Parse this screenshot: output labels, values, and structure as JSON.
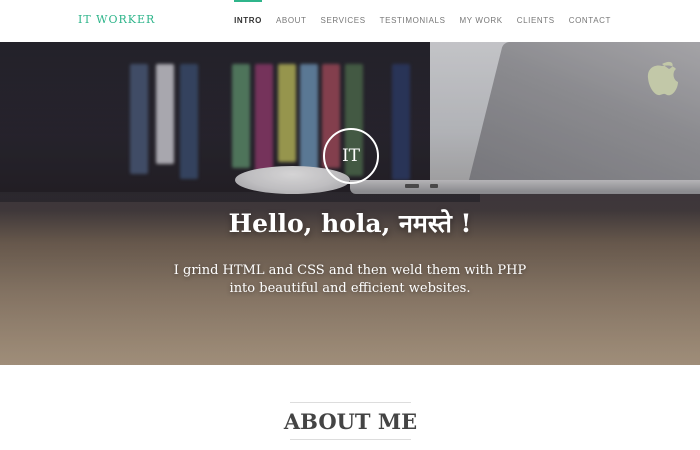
{
  "brand": {
    "name": "IT WORKER"
  },
  "nav": {
    "items": [
      {
        "label": "INTRO",
        "active": true
      },
      {
        "label": "ABOUT"
      },
      {
        "label": "SERVICES"
      },
      {
        "label": "TESTIMONIALS"
      },
      {
        "label": "MY WORK"
      },
      {
        "label": "CLIENTS"
      },
      {
        "label": "CONTACT"
      }
    ]
  },
  "hero": {
    "logo_text": "IT",
    "title": "Hello, hola, नमस्ते !",
    "subtitle": "I grind HTML and CSS and then weld them with PHP into beautiful and efficient websites."
  },
  "about": {
    "heading": "ABOUT ME"
  },
  "colors": {
    "accent": "#2fb58b",
    "nav_text": "#777777",
    "nav_active": "#333333"
  }
}
